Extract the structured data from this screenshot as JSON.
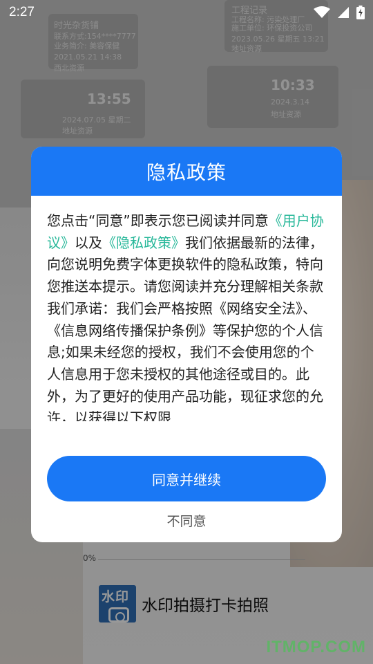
{
  "status_bar": {
    "time": "2:27"
  },
  "background": {
    "cards": [
      {
        "title": "时光杂货铺",
        "line1": "联系方式:154****7777",
        "line2": "业务简介: 美容保健",
        "date": "2021.05.21 14:38",
        "place": "西北资源"
      },
      {
        "title": "工程记录",
        "line1": "工程名称: 污染处理厂",
        "line2": "施工单位: 环保投资公司",
        "date": "2023.05.26 星期五 13:21",
        "place": "地址资源"
      },
      {
        "clock": "13:55",
        "date": "2024.07.05 星期二",
        "place": "地址资源"
      },
      {
        "clock": "10:33",
        "date": "2024.3.14",
        "place": "地址资源"
      }
    ],
    "progress_label": "0%",
    "app_icon_text": "水印",
    "app_name": "水印拍摄打卡拍照",
    "watermark": "ITMOP.COM"
  },
  "dialog": {
    "title": "隐私政策",
    "text_pre": "您点击“同意”即表示您已阅读并同意",
    "link_user": "《用户协议》",
    "text_mid": "以及",
    "link_privacy": "《隐私政策》",
    "text_post": "我们依据最新的法律，向您说明免费字体更换软件的隐私政策，特向您推送本提示。请您阅读并充分理解相关条款我们承诺：我们会严格按照《网络安全法》、《信息网络传播保护条例》等保护您的个人信息;如果未经您的授权，我们不会使用您的个人信息用于您未授权的其他途径或目的。此外，为了更好的使用产品功能，现征求您的允许，以获得以下权限",
    "agree_label": "同意并继续",
    "disagree_label": "不同意"
  },
  "colors": {
    "accent": "#1a78f5",
    "link": "#29b89a"
  }
}
